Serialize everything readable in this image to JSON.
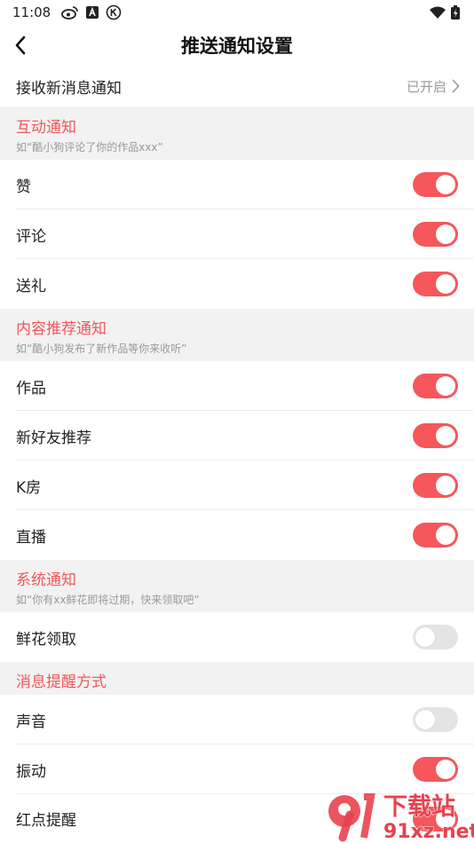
{
  "status": {
    "time": "11:08"
  },
  "header": {
    "title": "推送通知设置"
  },
  "receive": {
    "label": "接收新消息通知",
    "value": "已开启"
  },
  "sections": [
    {
      "title": "互动通知",
      "desc": "如“酷小狗评论了你的作品xxx”",
      "items": [
        {
          "label": "赞",
          "enabled": true
        },
        {
          "label": "评论",
          "enabled": true
        },
        {
          "label": "送礼",
          "enabled": true
        }
      ]
    },
    {
      "title": "内容推荐通知",
      "desc": "如“酷小狗发布了新作品等你来收听”",
      "items": [
        {
          "label": "作品",
          "enabled": true
        },
        {
          "label": "新好友推荐",
          "enabled": true
        },
        {
          "label": "K房",
          "enabled": true
        },
        {
          "label": "直播",
          "enabled": true
        }
      ]
    },
    {
      "title": "系统通知",
      "desc": "如“你有xx鲜花即将过期，快来领取吧”",
      "items": [
        {
          "label": "鲜花领取",
          "enabled": false
        }
      ]
    },
    {
      "title": "消息提醒方式",
      "desc": "",
      "items": [
        {
          "label": "声音",
          "enabled": false
        },
        {
          "label": "振动",
          "enabled": true
        },
        {
          "label": "红点提醒",
          "enabled": true
        }
      ]
    }
  ],
  "watermark": {
    "text": "下载站",
    "domain": "91xz.net"
  },
  "colors": {
    "accent": "#f5575b",
    "section_title": "#f0575b",
    "section_bg": "#f2f2f2"
  }
}
